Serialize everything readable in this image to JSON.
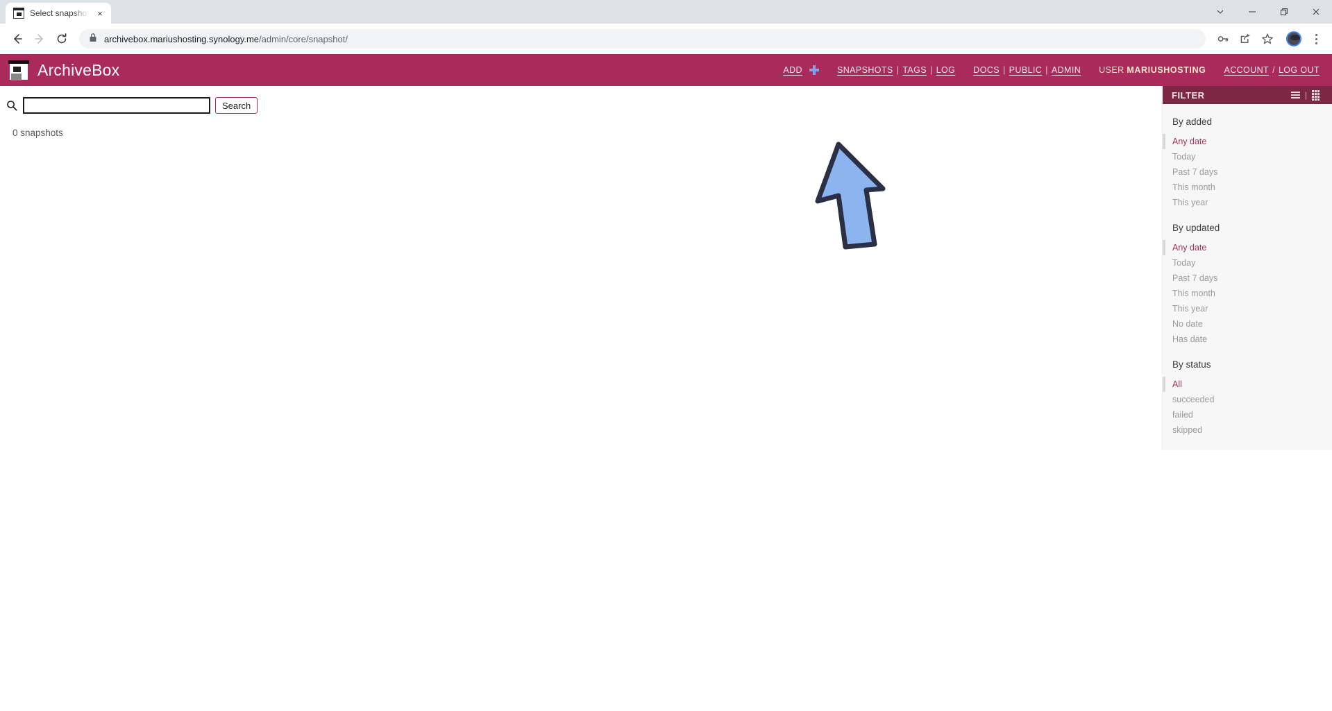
{
  "browser": {
    "tab": {
      "title": "Select snapshot to",
      "favicon_name": "archivebox-favicon",
      "close_label": "×"
    },
    "window_controls": [
      {
        "name": "tab-search-button",
        "glyph": "⌄"
      },
      {
        "name": "minimize-button",
        "glyph": "−"
      },
      {
        "name": "restore-button",
        "glyph": "❐"
      },
      {
        "name": "close-window-button",
        "glyph": "✕"
      }
    ],
    "toolbar": {
      "back_glyph": "←",
      "forward_glyph": "→",
      "reload_glyph": "↻",
      "lock_name": "site-lock-icon",
      "url_domain": "archivebox.mariushosting.synology.me",
      "url_path": "/admin/core/snapshot/",
      "actions": [
        {
          "name": "password-key-icon",
          "glyph": "⚷"
        },
        {
          "name": "share-icon",
          "glyph": "↱"
        },
        {
          "name": "bookmark-star-icon",
          "glyph": "☆"
        }
      ],
      "profile_name": "profile-avatar",
      "menu_name": "chrome-menu-button"
    }
  },
  "app": {
    "brand": "ArchiveBox",
    "nav": {
      "add_label": "ADD",
      "add_plus_icon": "plus-icon",
      "group_snapshots": [
        "SNAPSHOTS",
        "TAGS",
        "LOG"
      ],
      "group_docs": [
        "DOCS",
        "PUBLIC",
        "ADMIN"
      ],
      "user_prefix": "USER",
      "user_name": "MARIUSHOSTING",
      "account_label": "ACCOUNT",
      "account_sep": "/",
      "logout_label": "LOG OUT",
      "separator": "|"
    },
    "search": {
      "icon_name": "search-icon",
      "value": "",
      "placeholder": "",
      "button_label": "Search"
    },
    "results": {
      "count_text": "0 snapshots"
    },
    "filter": {
      "title": "FILTER",
      "view_list_icon": "list-view-icon",
      "view_grid_icon": "grid-view-icon",
      "sections": [
        {
          "heading": "By added",
          "items": [
            {
              "label": "Any date",
              "selected": true
            },
            {
              "label": "Today",
              "selected": false
            },
            {
              "label": "Past 7 days",
              "selected": false
            },
            {
              "label": "This month",
              "selected": false
            },
            {
              "label": "This year",
              "selected": false
            }
          ]
        },
        {
          "heading": "By updated",
          "items": [
            {
              "label": "Any date",
              "selected": true
            },
            {
              "label": "Today",
              "selected": false
            },
            {
              "label": "Past 7 days",
              "selected": false
            },
            {
              "label": "This month",
              "selected": false
            },
            {
              "label": "This year",
              "selected": false
            },
            {
              "label": "No date",
              "selected": false
            },
            {
              "label": "Has date",
              "selected": false
            }
          ]
        },
        {
          "heading": "By status",
          "items": [
            {
              "label": "All",
              "selected": true
            },
            {
              "label": "succeeded",
              "selected": false
            },
            {
              "label": "failed",
              "selected": false
            },
            {
              "label": "skipped",
              "selected": false
            }
          ]
        }
      ]
    }
  },
  "annotation": {
    "cursor_name": "pointer-arrow-annotation",
    "fill": "#8cb4ee",
    "stroke": "#2b3044"
  },
  "colors": {
    "brand_maroon": "#aa2a5c",
    "filter_header": "#7c2844",
    "selected_text": "#a2335c",
    "panel_bg": "#f7f7f7"
  }
}
